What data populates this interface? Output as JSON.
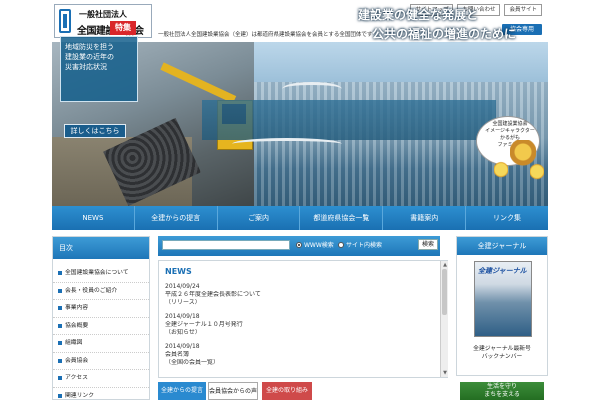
{
  "header": {
    "logo_sub": "一般社団法人",
    "logo_main": "全国建設業協会",
    "tagline": "一般社団法人全国建設業協会（全建）は都道府県建設業協会を会員とする全国団体です",
    "top_links": [
      "サイトマップ",
      "お問い合わせ",
      "会員サイト"
    ],
    "member_button": "協会専用"
  },
  "hero": {
    "headline_line1": "建設業の健全な発展と",
    "headline_line2": "公共の福祉の増進のために",
    "badge": "特集",
    "feature_lines": [
      "地域防災を担う",
      "建設業の近年の",
      "災害対応状況"
    ],
    "feature_button": "詳しくはこちら",
    "mascot_lines": [
      "全国建設業協会",
      "イメージキャラクター",
      "かるがも",
      "ファミリー"
    ]
  },
  "nav": {
    "items": [
      "NEWS",
      "全建からの提言",
      "ご案内",
      "都道府県協会一覧",
      "書籍案内",
      "リンク集"
    ]
  },
  "sidebar": {
    "title": "目次",
    "items": [
      "全国建設業協会について",
      "会長・役員のご紹介",
      "事業内容",
      "協会概要",
      "組織図",
      "会員協会",
      "アクセス",
      "関連リンク"
    ]
  },
  "search": {
    "placeholder": "",
    "radio_www": "WWW検索",
    "radio_site": "サイト内検索",
    "button": "検索"
  },
  "news": {
    "title": "NEWS",
    "entries": [
      {
        "date": "2014/09/24",
        "line1": "平成２６年度全建会長表彰について",
        "line2": "（リリース）"
      },
      {
        "date": "2014/09/18",
        "line1": "全建ジャーナル１０月号発行",
        "line2": "（お知らせ）"
      },
      {
        "date": "2014/09/18",
        "line1": "会員名簿",
        "line2": "（全国の会員一覧）"
      }
    ]
  },
  "bottom_tabs": [
    "全建からの提言",
    "会員協会からの声",
    "全建の取り組み"
  ],
  "right_sidebar": {
    "title": "全建ジャーナル",
    "magazine_title": "全建ジャーナル",
    "caption_line1": "全建ジャーナル最新号",
    "caption_line2": "バックナンバー"
  },
  "green_banner": [
    "生活を守り",
    "まちを支える"
  ]
}
